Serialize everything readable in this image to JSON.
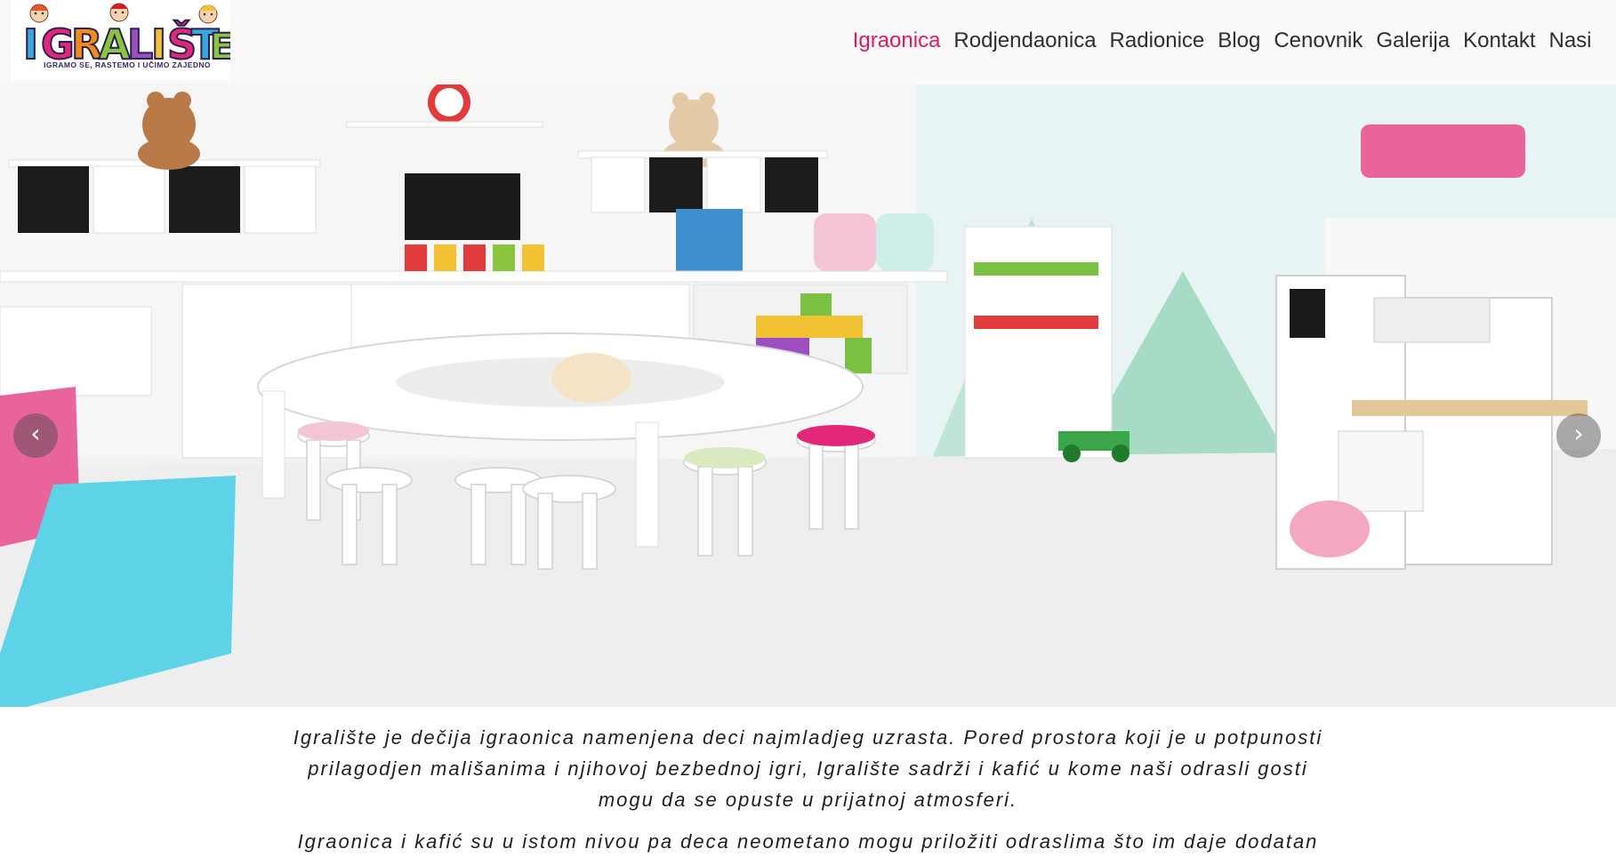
{
  "brand": {
    "logo_text": "IGRALIŠTE",
    "tagline": "IGRAMO SE, RASTEMO I UČIMO ZAJEDNO"
  },
  "nav": {
    "items": [
      {
        "label": "Igraonica",
        "active": true
      },
      {
        "label": "Rodjendaonica",
        "active": false
      },
      {
        "label": "Radionice",
        "active": false
      },
      {
        "label": "Blog",
        "active": false
      },
      {
        "label": "Cenovnik",
        "active": false
      },
      {
        "label": "Galerija",
        "active": false
      },
      {
        "label": "Kontakt",
        "active": false
      },
      {
        "label": "Nasi",
        "active": false
      }
    ]
  },
  "carousel": {
    "prev_label": "‹",
    "next_label": "›"
  },
  "intro": {
    "paragraph_1": "Igralište je dečija igraonica namenjena deci najmladjeg uzrasta. Pored prostora koji je u potpunosti prilagodjen mališanima i njihovoj bezbednoj igri, Igralište sadrži i kafić u kome naši odrasli gosti mogu da se opuste u prijatnoj atmosferi.",
    "paragraph_2": "Igraonica i kafić su u istom nivou pa deca neometano mogu priložiti odraslima što im daje dodatan"
  },
  "colors": {
    "nav_active": "#e0195c",
    "nav_default": "#2f2f2f",
    "header_bg": "#fbf8f8"
  }
}
